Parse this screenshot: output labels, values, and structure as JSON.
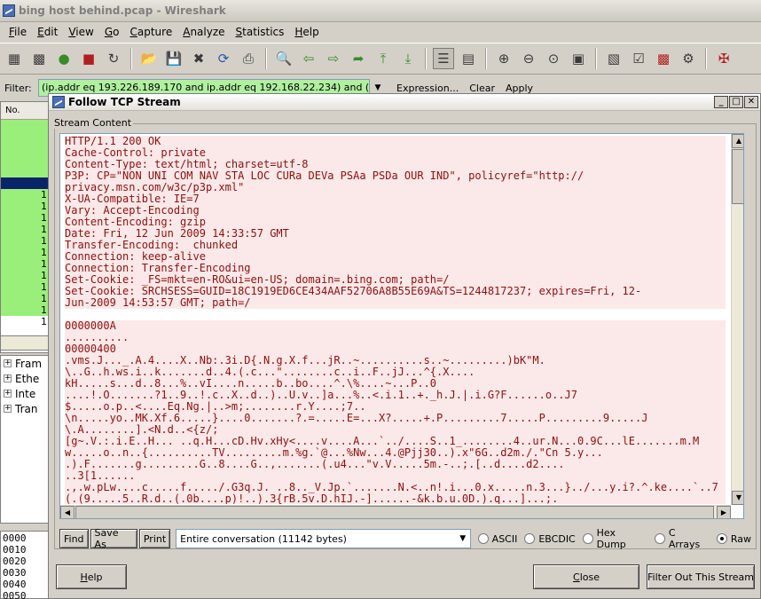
{
  "window": {
    "title": "bing host behind.pcap - Wireshark",
    "menus": [
      "File",
      "Edit",
      "View",
      "Go",
      "Capture",
      "Analyze",
      "Statistics",
      "Help"
    ]
  },
  "filter": {
    "label": "Filter:",
    "value": "(ip.addr eq 193.226.189.170 and ip.addr eq 192.168.22.234) and (tcp.port",
    "expression_label": "Expression...",
    "clear_label": "Clear",
    "apply_label": "Apply"
  },
  "packet_list": {
    "column_no": "No. ",
    "row_numbers": [
      "",
      "",
      "",
      "",
      "",
      "",
      "1",
      "1",
      "1",
      "1",
      "1",
      "1",
      "1",
      "1",
      "1",
      "1",
      "1",
      "1"
    ]
  },
  "details_tree": [
    "Fram",
    "Ethe",
    "Inte",
    "Tran"
  ],
  "hex_offsets": [
    "0000",
    "0010",
    "0020",
    "0030",
    "0040",
    "0050"
  ],
  "dialog": {
    "title": "Follow TCP Stream",
    "group_label": "Stream Content",
    "stream_lines": [
      "HTTP/1.1 200 OK",
      "Cache-Control: private",
      "Content-Type: text/html; charset=utf-8",
      "P3P: CP=\"NON UNI COM NAV STA LOC CURa DEVa PSAa PSDa OUR IND\", policyref=\"http://",
      "privacy.msn.com/w3c/p3p.xml\"",
      "X-UA-Compatible: IE=7",
      "Vary: Accept-Encoding",
      "Content-Encoding: gzip",
      "Date: Fri, 12 Jun 2009 14:33:57 GMT",
      "Transfer-Encoding:  chunked",
      "Connection: keep-alive",
      "Connection: Transfer-Encoding",
      "Set-Cookie: _FS=mkt=en-RO&ui=en-US; domain=.bing.com; path=/",
      "Set-Cookie: SRCHSESS=GUID=18C1919ED6CE434AAF52706A8B55E69A&TS=1244817237; expires=Fri, 12-",
      "Jun-2009 14:53:57 GMT; path=/",
      "",
      "0000000A",
      "..........",
      "00000400",
      ".vms.J..._.A.4....X..Nb:.3i.D{.N.g.X.f...jR..~..........s..~.........)bK\"M.",
      "\\..G..h.ws.i..k.......d..4.(.c...\"........c..i..F..jJ...^{.X....",
      "kH.....s...d..8...%..vI....n.....b..bo....^.\\%....~...P..0",
      "....!.O.......?1..9..!.c..X..d..)..U.v..]a...%..<.i.1..+._h.J.|.i.G?F......o..J7",
      "$.....o.p..<....Eq.Ng.|..>m;........r.Y....;7..",
      "\\n.....yo..MK.Xf.6.....}....0.......?.=.....E=...X?.....+.P.........7.....P.........9.....J",
      "\\.A........].<N.d..<{z/;",
      "[g~.V.:.i.E..H... ..q.H...cD.Hv.xHy<....v....A...`../....S..1_........4..ur.N...0.9C...lE.......m.M",
      "w.....o..n..{..........TV.........m.%g.`@...%Nw...4.@Pjj30..).x\"6G..d2m./.\"Cn 5.y...",
      ".).F.......g.........G..8....G..,.......(.u4...\"v.V.....5m.-..;.[..d....d2....",
      "..3[1......",
      ".,.w.pLw....c.....f...../.G3q.J. ..8.._V.Jp.`.......N.<..n!.i...0.x.....n.3...}../...y.i?.^.ke....`..7",
      "(.(9.....5..R.d..(.0b....p)!..).3{rB.5v.D.hIJ.-]......-&k.b.u.0D.).q...]...;."
    ],
    "controls": {
      "find_label": "Find",
      "save_as_label": "Save As",
      "print_label": "Print",
      "conversation_selected": "Entire conversation (11142 bytes)",
      "format_options": [
        "ASCII",
        "EBCDIC",
        "Hex Dump",
        "C Arrays",
        "Raw"
      ],
      "format_selected": "Raw"
    },
    "help_label": "Help",
    "close_label": "Close",
    "filter_out_label": "Filter Out This Stream"
  },
  "colors": {
    "stream_text": "#8b1010",
    "stream_highlight": "#fbe8e8",
    "filter_valid": "#b0f0a0",
    "packet_green": "#9aef7a",
    "packet_selected": "#0a246a"
  }
}
